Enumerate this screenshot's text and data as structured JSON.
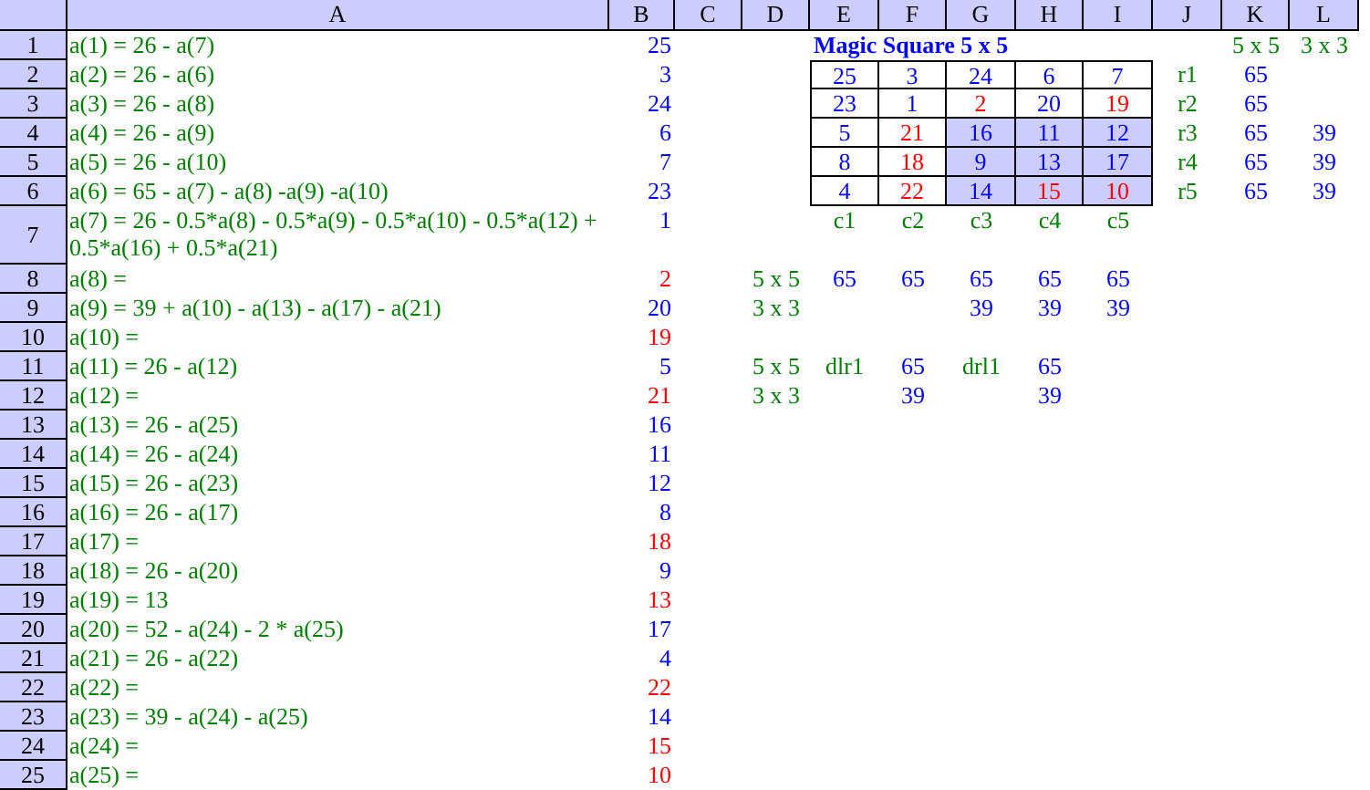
{
  "column_headers": [
    "A",
    "B",
    "C",
    "D",
    "E",
    "F",
    "G",
    "H",
    "I",
    "J",
    "K",
    "L"
  ],
  "row_headers": [
    "1",
    "2",
    "3",
    "4",
    "5",
    "6",
    "7",
    "8",
    "9",
    "10",
    "11",
    "12",
    "13",
    "14",
    "15",
    "16",
    "17",
    "18",
    "19",
    "20",
    "21",
    "22",
    "23",
    "24",
    "25"
  ],
  "formulas": [
    {
      "text": "a(1) = 26 - a(7)",
      "value": "25",
      "color": "#0000ff"
    },
    {
      "text": "a(2) = 26 - a(6)",
      "value": "3",
      "color": "#0000ff"
    },
    {
      "text": "a(3) = 26 - a(8)",
      "value": "24",
      "color": "#0000ff"
    },
    {
      "text": "a(4) = 26 - a(9)",
      "value": "6",
      "color": "#0000ff"
    },
    {
      "text": "a(5) = 26 - a(10)",
      "value": "7",
      "color": "#0000ff"
    },
    {
      "text": "a(6) = 65 - a(7) - a(8) -a(9) -a(10)",
      "value": "23",
      "color": "#0000ff"
    },
    {
      "text": "a(7) = 26 - 0.5*a(8) - 0.5*a(9) - 0.5*a(10) - 0.5*a(12) + 0.5*a(16) + 0.5*a(21)",
      "value": "1",
      "color": "#0000ff"
    },
    {
      "text": "a(8) =",
      "value": "2",
      "color": "#ff0000"
    },
    {
      "text": "a(9) = 39 + a(10) - a(13) - a(17) - a(21)",
      "value": "20",
      "color": "#0000ff"
    },
    {
      "text": "a(10) =",
      "value": "19",
      "color": "#ff0000"
    },
    {
      "text": "a(11) = 26 - a(12)",
      "value": "5",
      "color": "#0000ff"
    },
    {
      "text": "a(12) =",
      "value": "21",
      "color": "#ff0000"
    },
    {
      "text": "a(13) = 26 - a(25)",
      "value": "16",
      "color": "#0000ff"
    },
    {
      "text": "a(14) = 26 - a(24)",
      "value": "11",
      "color": "#0000ff"
    },
    {
      "text": "a(15) = 26 - a(23)",
      "value": "12",
      "color": "#0000ff"
    },
    {
      "text": "a(16) = 26 - a(17)",
      "value": "8",
      "color": "#0000ff"
    },
    {
      "text": "a(17) =",
      "value": "18",
      "color": "#ff0000"
    },
    {
      "text": "a(18) = 26 - a(20)",
      "value": "9",
      "color": "#0000ff"
    },
    {
      "text": "a(19) = 13",
      "value": "13",
      "color": "#ff0000"
    },
    {
      "text": "a(20) = 52 - a(24) - 2 * a(25)",
      "value": "17",
      "color": "#0000ff"
    },
    {
      "text": "a(21) = 26 - a(22)",
      "value": "4",
      "color": "#0000ff"
    },
    {
      "text": "a(22) =",
      "value": "22",
      "color": "#ff0000"
    },
    {
      "text": "a(23) = 39 - a(24) - a(25)",
      "value": "14",
      "color": "#0000ff"
    },
    {
      "text": "a(24) =",
      "value": "15",
      "color": "#ff0000"
    },
    {
      "text": "a(25) =",
      "value": "10",
      "color": "#ff0000"
    }
  ],
  "magic_square": {
    "title": "Magic Square 5 x 5",
    "rows": [
      [
        {
          "text": "25",
          "color": "#0000ff",
          "shaded": false
        },
        {
          "text": "3",
          "color": "#0000ff",
          "shaded": false
        },
        {
          "text": "24",
          "color": "#0000ff",
          "shaded": false
        },
        {
          "text": "6",
          "color": "#0000ff",
          "shaded": false
        },
        {
          "text": "7",
          "color": "#0000ff",
          "shaded": false
        }
      ],
      [
        {
          "text": "23",
          "color": "#0000ff",
          "shaded": false
        },
        {
          "text": "1",
          "color": "#0000ff",
          "shaded": false
        },
        {
          "text": "2",
          "color": "#ff0000",
          "shaded": false
        },
        {
          "text": "20",
          "color": "#0000ff",
          "shaded": false
        },
        {
          "text": "19",
          "color": "#ff0000",
          "shaded": false
        }
      ],
      [
        {
          "text": "5",
          "color": "#0000ff",
          "shaded": false
        },
        {
          "text": "21",
          "color": "#ff0000",
          "shaded": false
        },
        {
          "text": "16",
          "color": "#0000ff",
          "shaded": true
        },
        {
          "text": "11",
          "color": "#0000ff",
          "shaded": true
        },
        {
          "text": "12",
          "color": "#0000ff",
          "shaded": true
        }
      ],
      [
        {
          "text": "8",
          "color": "#0000ff",
          "shaded": false
        },
        {
          "text": "18",
          "color": "#ff0000",
          "shaded": false
        },
        {
          "text": "9",
          "color": "#0000ff",
          "shaded": true
        },
        {
          "text": "13",
          "color": "#0000ff",
          "shaded": true
        },
        {
          "text": "17",
          "color": "#0000ff",
          "shaded": true
        }
      ],
      [
        {
          "text": "4",
          "color": "#0000ff",
          "shaded": false
        },
        {
          "text": "22",
          "color": "#ff0000",
          "shaded": false
        },
        {
          "text": "14",
          "color": "#0000ff",
          "shaded": true
        },
        {
          "text": "15",
          "color": "#ff0000",
          "shaded": true
        },
        {
          "text": "10",
          "color": "#ff0000",
          "shaded": true
        }
      ]
    ]
  },
  "row_sums": {
    "header_5x5": "5 x 5",
    "header_3x3": "3 x 3",
    "rows": [
      {
        "label": "r1",
        "sum_5x5": "65"
      },
      {
        "label": "r2",
        "sum_5x5": "65"
      },
      {
        "label": "r3",
        "sum_5x5": "65",
        "sum_3x3": "39"
      },
      {
        "label": "r4",
        "sum_5x5": "65",
        "sum_3x3": "39"
      },
      {
        "label": "r5",
        "sum_5x5": "65",
        "sum_3x3": "39"
      }
    ]
  },
  "column_labels": [
    "c1",
    "c2",
    "c3",
    "c4",
    "c5"
  ],
  "column_sums": {
    "label_5x5": "5 x 5",
    "label_3x3": "3 x 3",
    "columns": [
      {
        "sum_5x5": "65"
      },
      {
        "sum_5x5": "65"
      },
      {
        "sum_5x5": "65",
        "sum_3x3": "39"
      },
      {
        "sum_5x5": "65",
        "sum_3x3": "39"
      },
      {
        "sum_5x5": "65",
        "sum_3x3": "39"
      }
    ]
  },
  "diagonal_sums": {
    "label_5x5": "5 x 5",
    "label_3x3": "3 x 3",
    "diagonals": [
      {
        "label": "dlr1",
        "sum_5x5": "65",
        "sum_3x3": "39"
      },
      {
        "label": "drl1",
        "sum_5x5": "65",
        "sum_3x3": "39"
      }
    ]
  }
}
